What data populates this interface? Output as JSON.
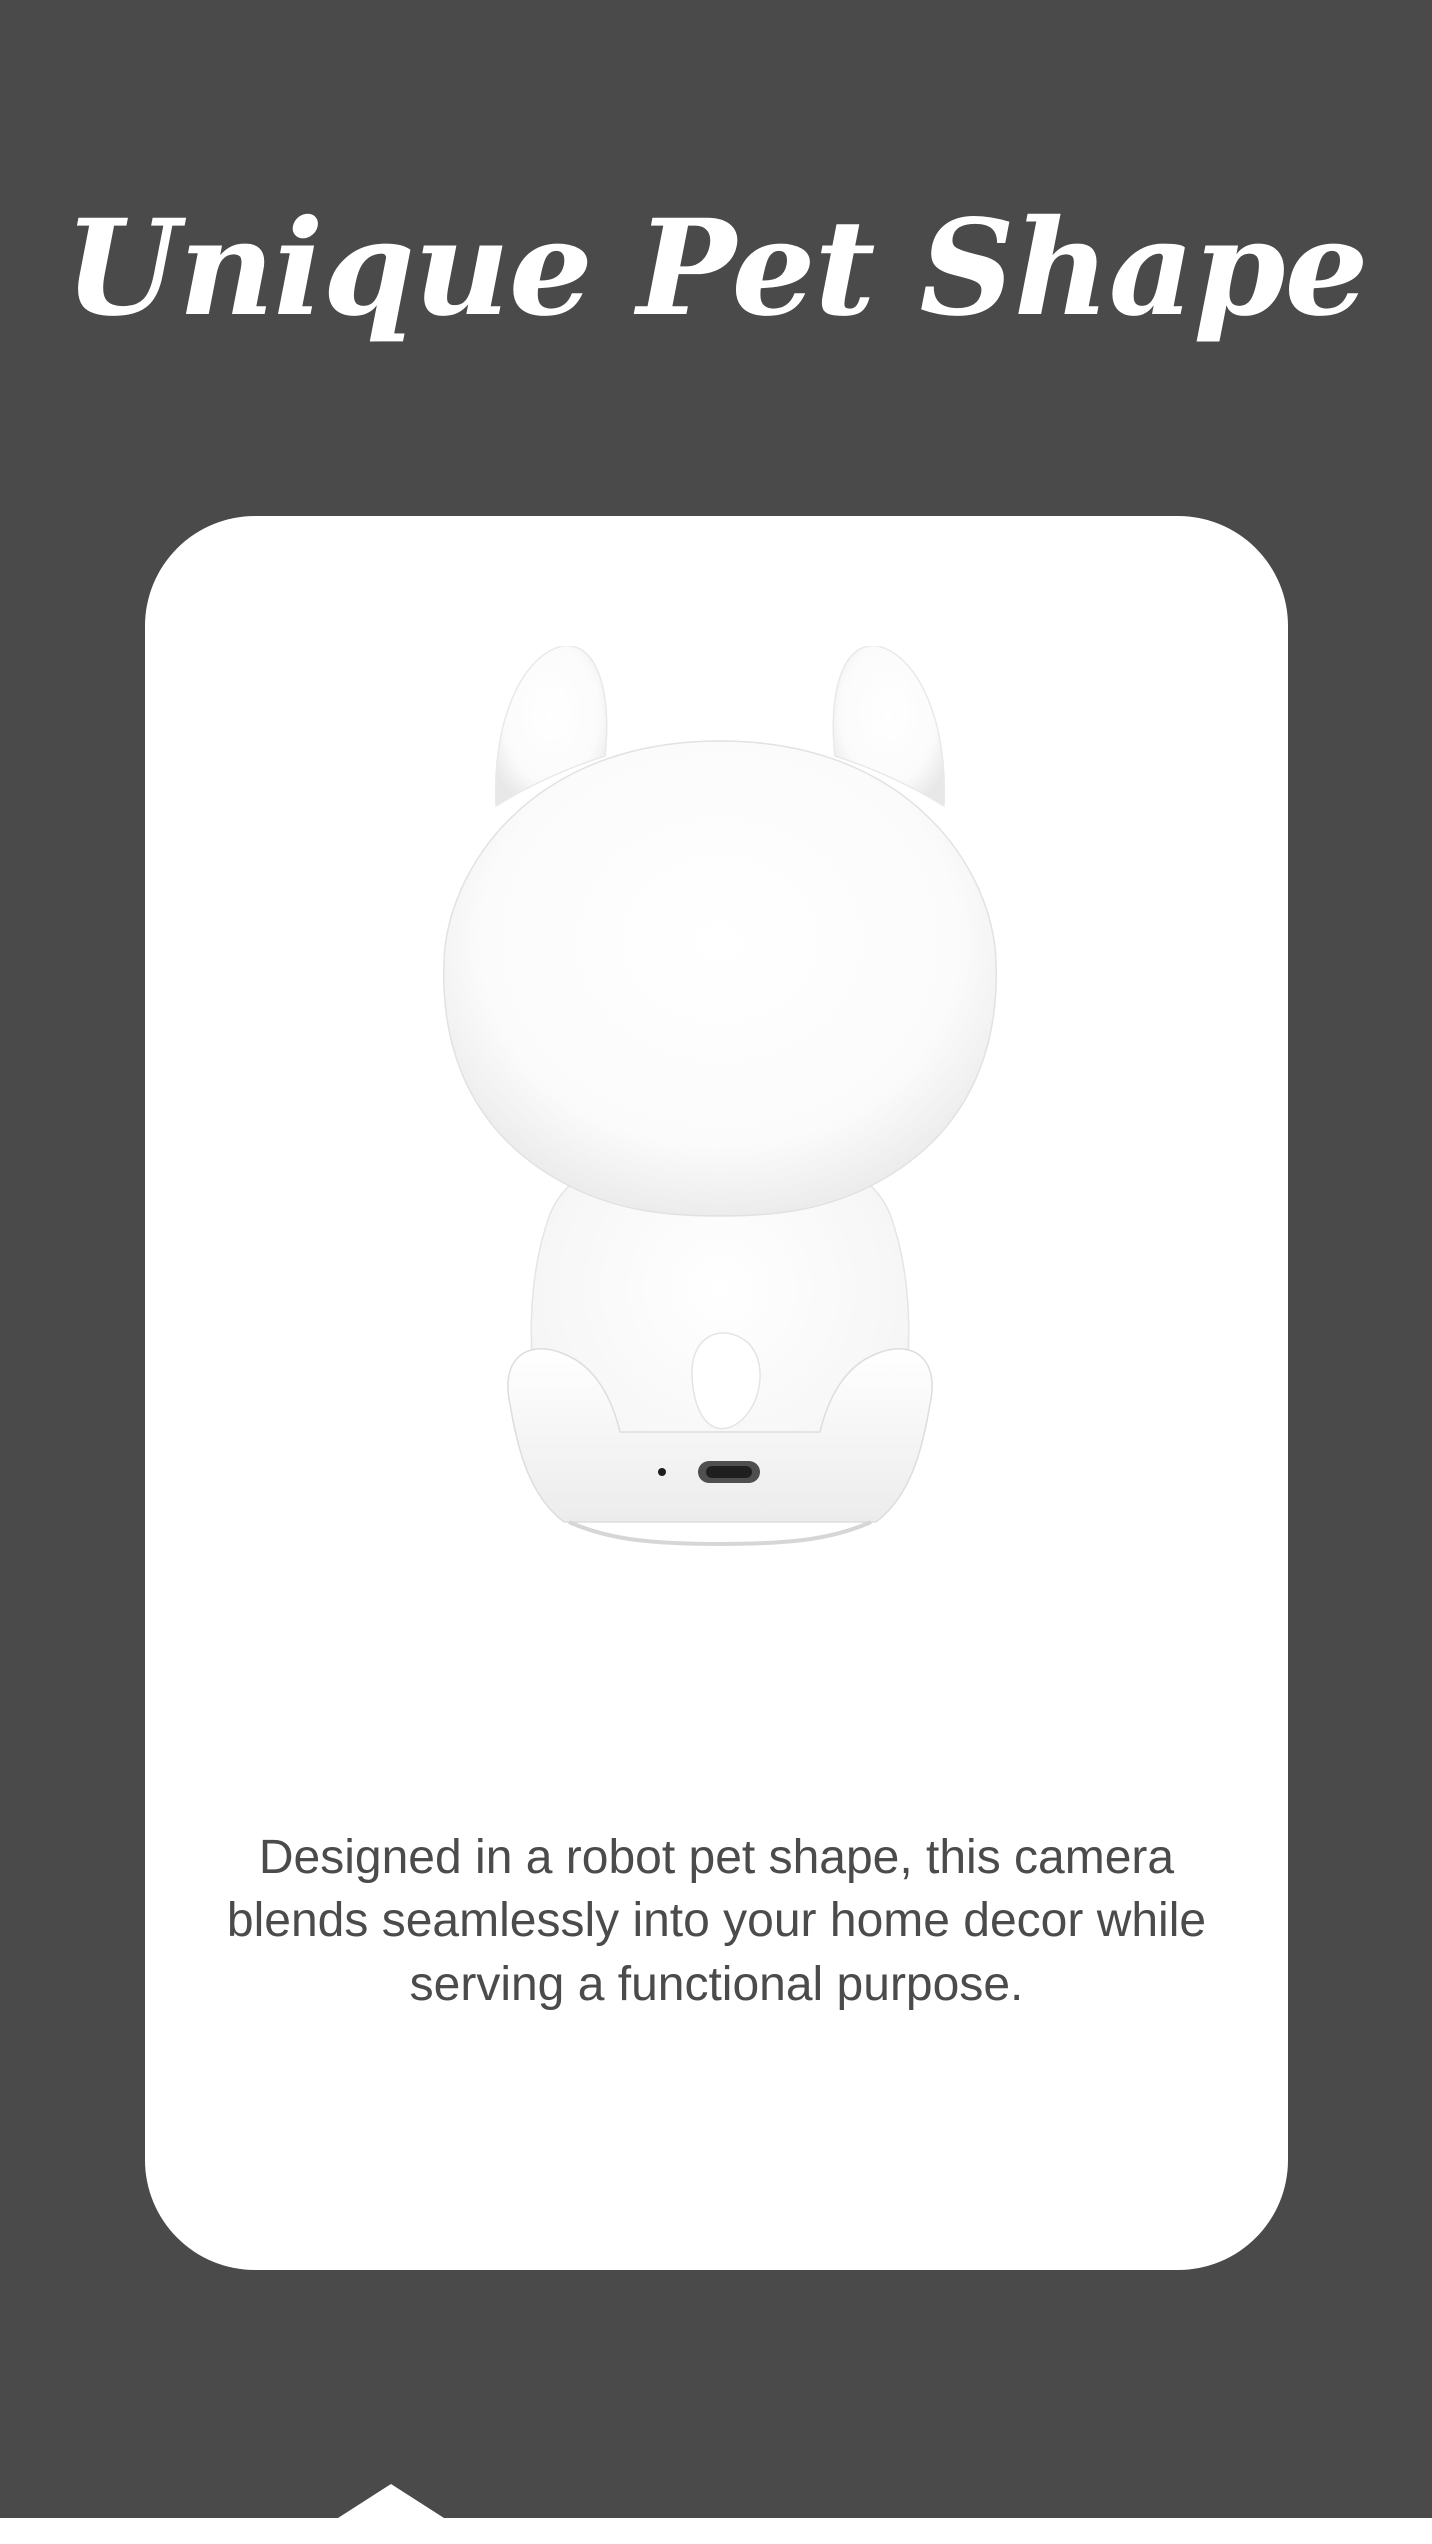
{
  "heading": {
    "title": "Unique Pet Shape"
  },
  "card": {
    "description": "Designed in a robot pet shape, this camera blends seamlessly into your home decor while serving a functional purpose.",
    "product_image": "robot-pet-camera-back-view"
  },
  "colors": {
    "background": "#4a4a4a",
    "card": "#ffffff",
    "title": "#ffffff",
    "body_text": "#4b4b4b"
  }
}
